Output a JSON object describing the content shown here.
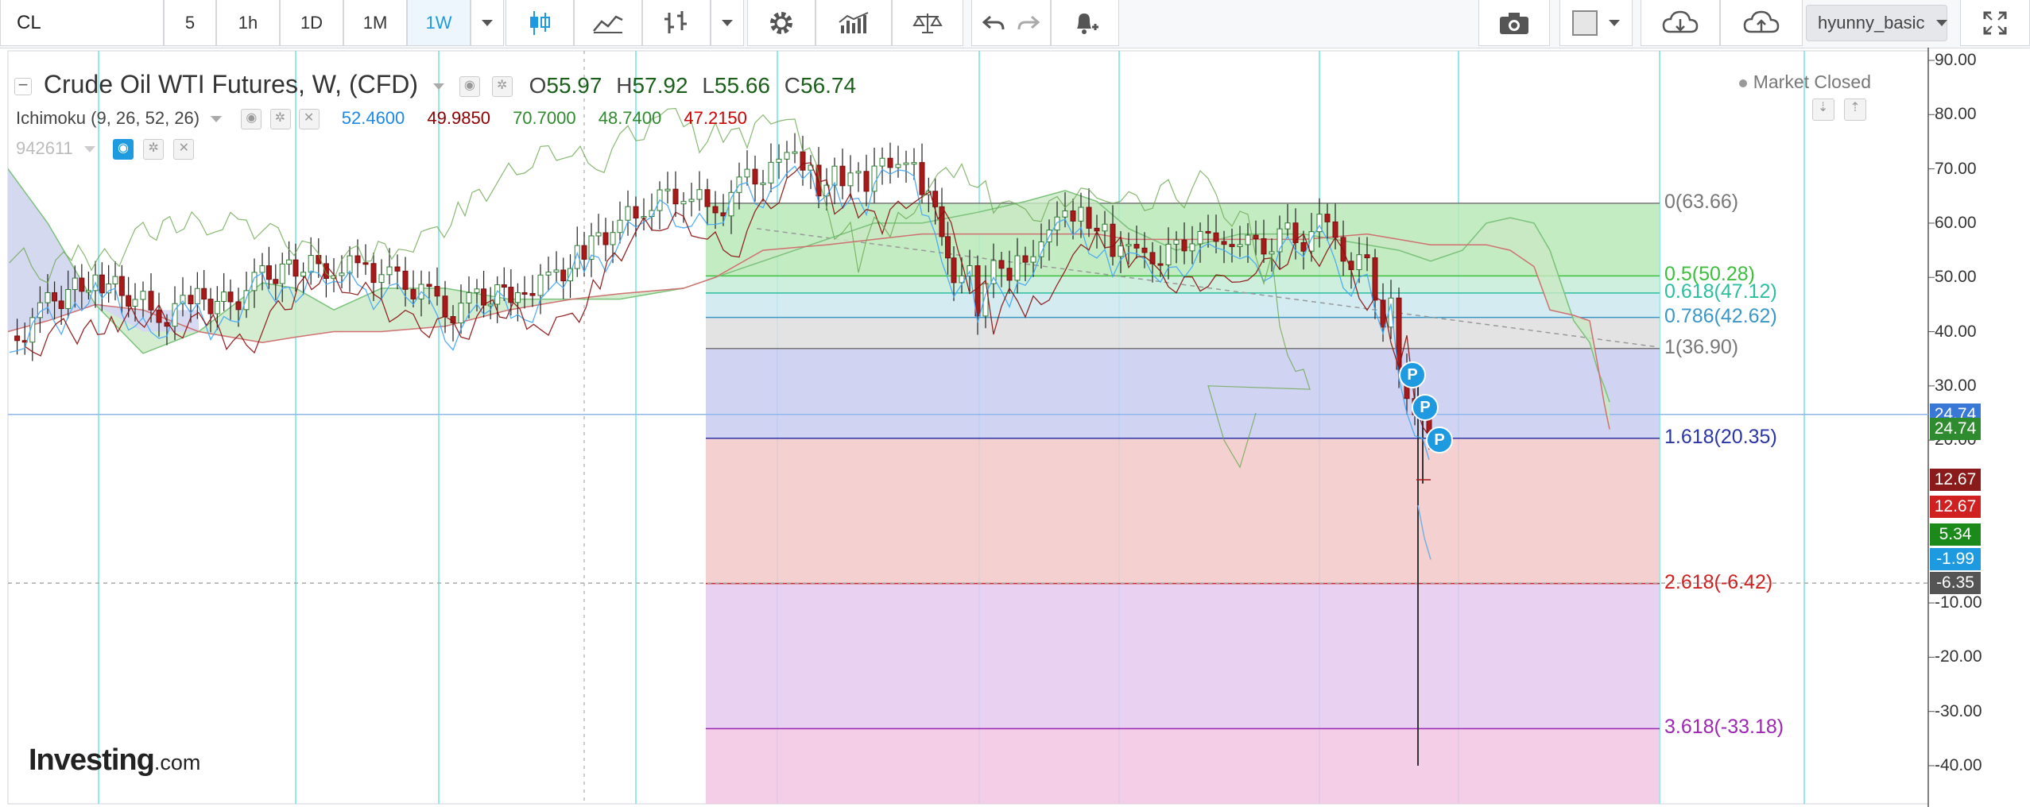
{
  "toolbar": {
    "symbol": "CL",
    "intervals": [
      "5",
      "1h",
      "1D",
      "1M",
      "1W"
    ],
    "active_interval": "1W",
    "user": "hyunny_basic",
    "accent": "#1e9be0"
  },
  "legend": {
    "title": "Crude Oil WTI Futures, W, (CFD)",
    "open_key": "O",
    "open": "55.97",
    "high_key": "H",
    "high": "57.92",
    "low_key": "L",
    "low": "55.66",
    "close_key": "C",
    "close": "56.74",
    "indicator": "Ichimoku (9, 26, 52, 26)",
    "ind_values": [
      "52.4600",
      "49.9850",
      "70.7000",
      "48.7400",
      "47.2150"
    ],
    "ind_colors": [
      "#1e88e5",
      "#8b0000",
      "#2e8b2e",
      "#2e8b2e",
      "#d00000"
    ],
    "second_indicator": "942611"
  },
  "status": "Market Closed",
  "brand": {
    "name": "Investing",
    "suffix": ".com"
  },
  "fib_levels": [
    {
      "label": "0(63.66)",
      "price": 63.66,
      "color": "#777777"
    },
    {
      "label": "0.5(50.28)",
      "price": 50.28,
      "color": "#3cbf3c"
    },
    {
      "label": "0.618(47.12)",
      "price": 47.12,
      "color": "#2bbfa0"
    },
    {
      "label": "0.786(42.62)",
      "price": 42.62,
      "color": "#3a98c9"
    },
    {
      "label": "1(36.90)",
      "price": 36.9,
      "color": "#777777"
    },
    {
      "label": "1.618(20.35)",
      "price": 20.35,
      "color": "#2a35a8"
    },
    {
      "label": "2.618(-6.42)",
      "price": -6.42,
      "color": "#d02020"
    },
    {
      "label": "3.618(-33.18)",
      "price": -33.18,
      "color": "#9c27b0"
    }
  ],
  "y_axis": {
    "ticks": [
      "90.00",
      "80.00",
      "70.00",
      "60.00",
      "50.00",
      "40.00",
      "30.00",
      "20.00",
      "-10.00",
      "-20.00",
      "-30.00",
      "-40.00"
    ],
    "min": -46,
    "max": 91
  },
  "price_tags": [
    {
      "text": "24.74",
      "price": 24.74,
      "color": "#3a78d8"
    },
    {
      "text": "24.74",
      "price": 22.0,
      "color": "#2e8b2e"
    },
    {
      "text": "12.67",
      "price": 12.67,
      "color": "#8b1a1a"
    },
    {
      "text": "12.67",
      "price": 7.7,
      "color": "#d02020"
    },
    {
      "text": "5.34",
      "price": 2.6,
      "color": "#1b8a1b"
    },
    {
      "text": "-1.99",
      "price": -1.99,
      "color": "#1e9be0"
    },
    {
      "text": "-6.35",
      "price": -6.35,
      "color": "#555555"
    }
  ],
  "markers": [
    "P",
    "P",
    "P"
  ]
}
